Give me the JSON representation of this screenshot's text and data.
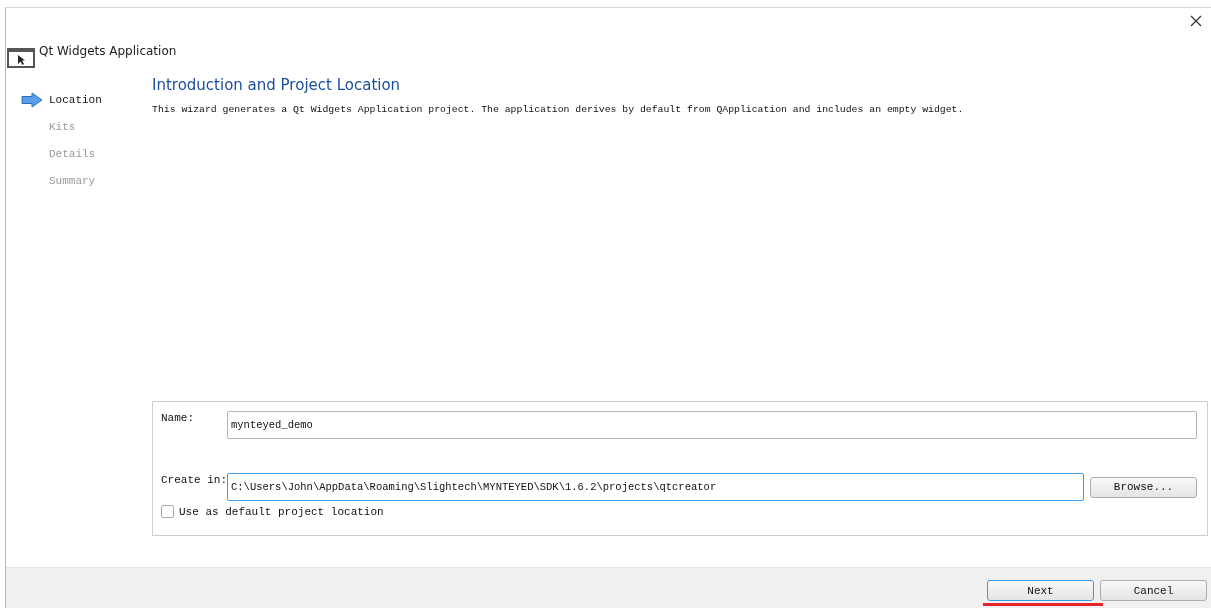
{
  "window": {
    "title": "Qt Widgets Application"
  },
  "steps": [
    {
      "label": "Location",
      "selected": true
    },
    {
      "label": "Kits",
      "selected": false
    },
    {
      "label": "Details",
      "selected": false
    },
    {
      "label": "Summary",
      "selected": false
    }
  ],
  "page": {
    "heading": "Introduction and Project Location",
    "description": "This wizard generates a Qt Widgets Application project. The application derives by default from QApplication and includes an empty widget."
  },
  "form": {
    "name_label": "Name:",
    "name_value": "mynteyed_demo",
    "create_label": "Create in:",
    "create_value": "C:\\Users\\John\\AppData\\Roaming\\Slightech\\MYNTEYED\\SDK\\1.6.2\\projects\\qtcreator",
    "browse": "Browse...",
    "default_checkbox": {
      "label": "Use as default project location",
      "checked": false
    }
  },
  "buttons": [
    {
      "label": "Next",
      "selected": true
    },
    {
      "label": "Cancel",
      "selected": false
    }
  ]
}
